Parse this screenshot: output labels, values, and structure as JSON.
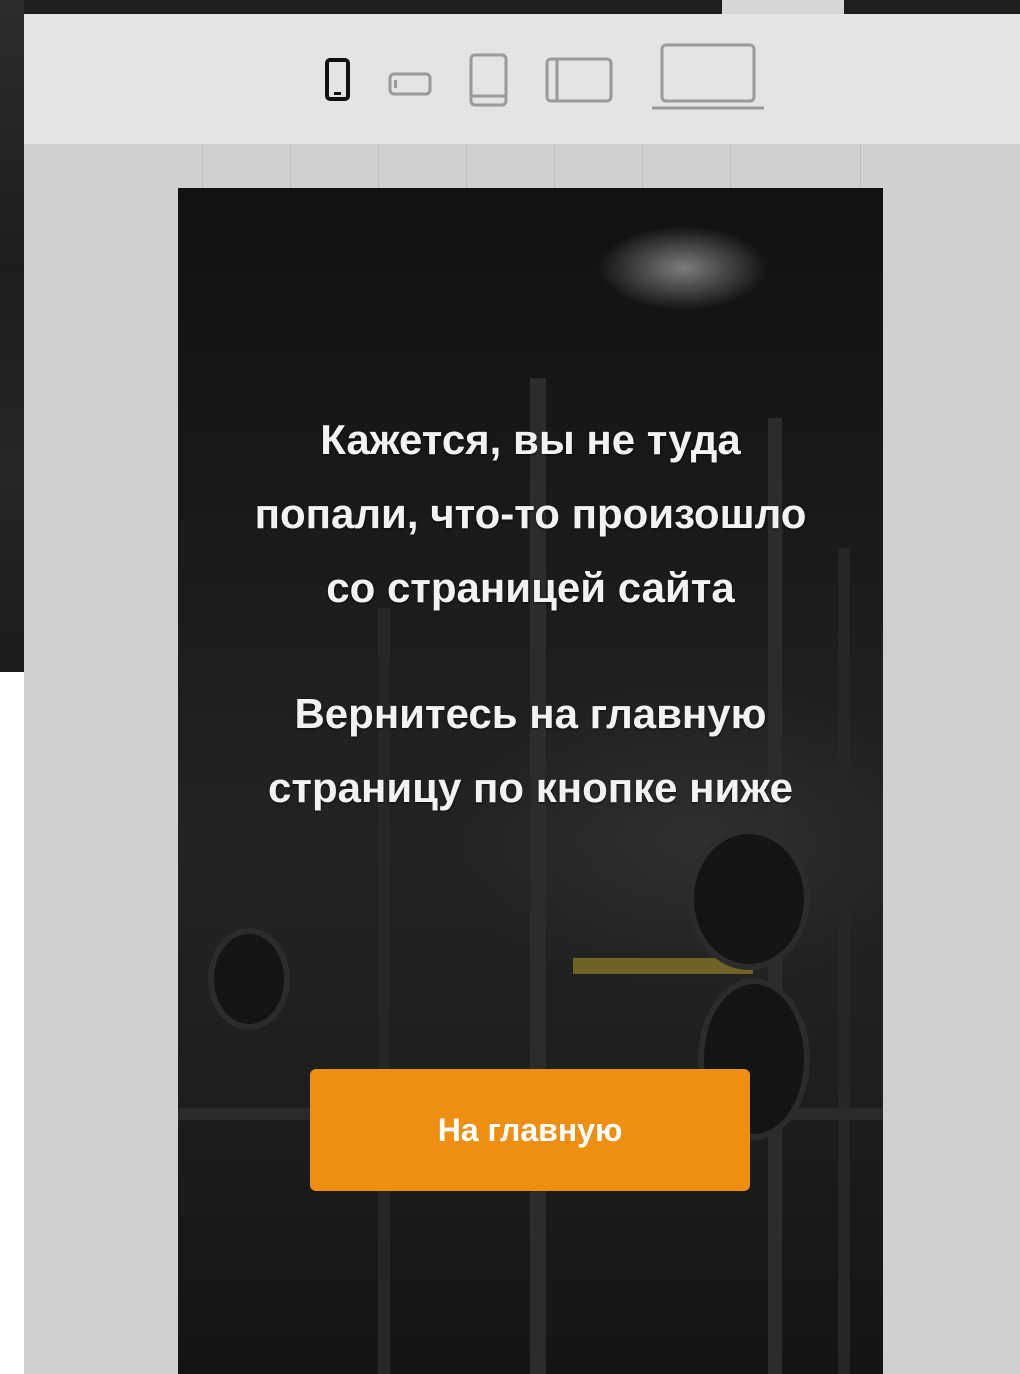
{
  "toolbar": {
    "devices": [
      {
        "name": "phone-portrait",
        "active": true
      },
      {
        "name": "phone-landscape",
        "active": false
      },
      {
        "name": "tablet-portrait",
        "active": false
      },
      {
        "name": "tablet-landscape",
        "active": false
      },
      {
        "name": "desktop",
        "active": false
      }
    ]
  },
  "page": {
    "message_line1": "Кажется, вы не туда",
    "message_line2": "попали, что-то произошло",
    "message_line3": "со страницей сайта",
    "hint_line1": "Вернитесь на главную",
    "hint_line2": "страницу по кнопке ниже",
    "button_label": "На главную"
  },
  "colors": {
    "accent": "#ef8f11",
    "toolbar_bg": "#e4e4e4",
    "canvas_bg": "#d0d0d0",
    "text": "#f2f2f2"
  }
}
